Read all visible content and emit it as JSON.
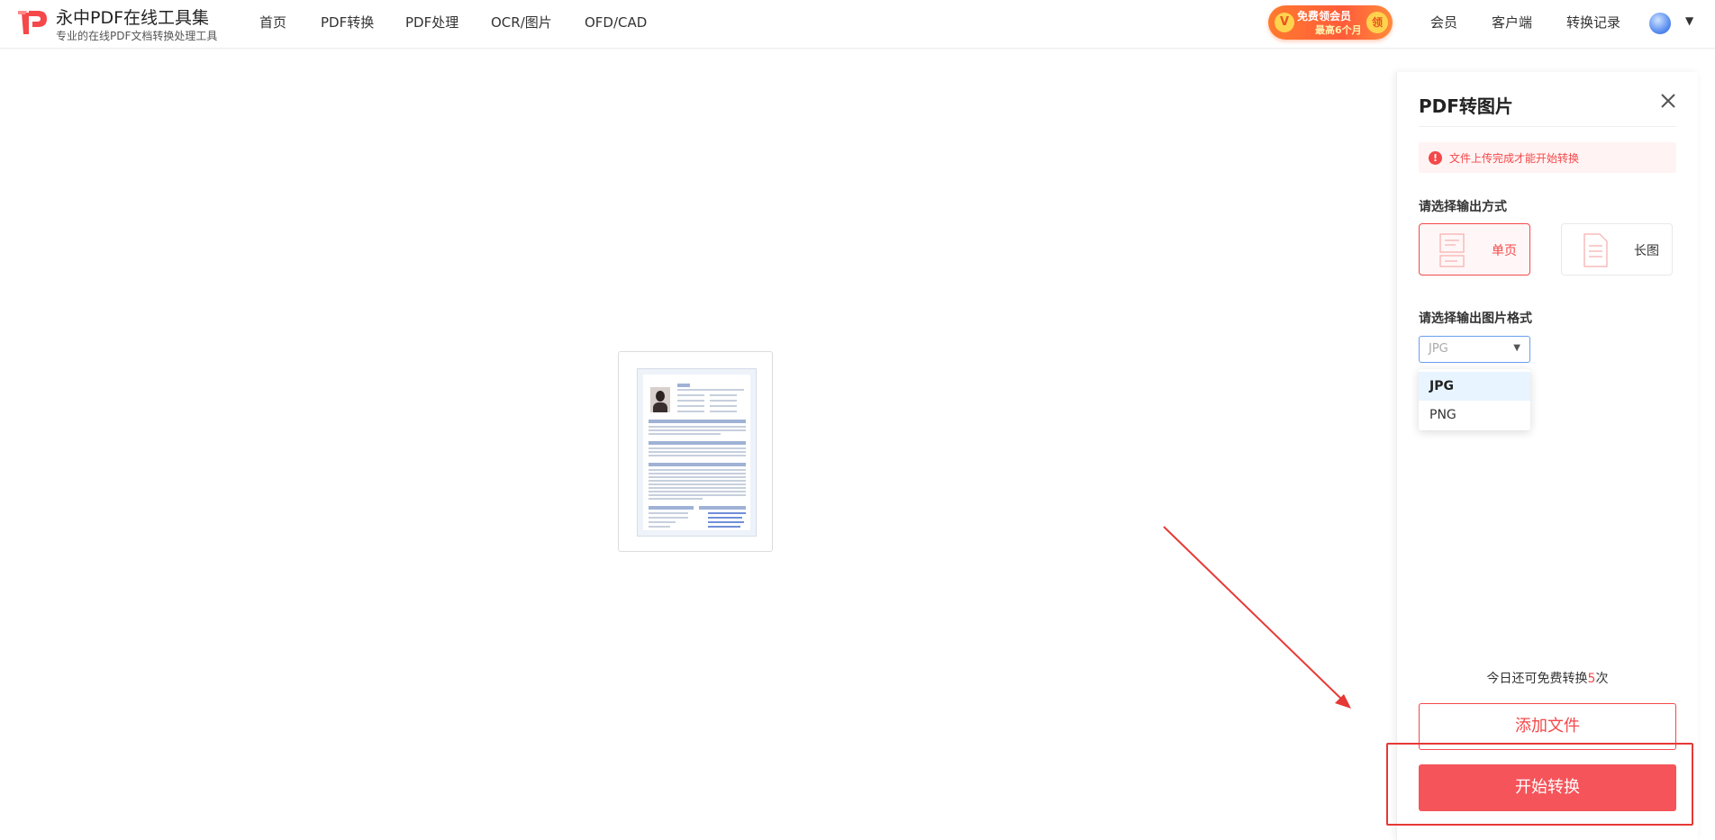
{
  "header": {
    "brand_title": "永中PDF在线工具集",
    "brand_subtitle": "专业的在线PDF文档转换处理工具",
    "nav": [
      "首页",
      "PDF转换",
      "PDF处理",
      "OCR/图片",
      "OFD/CAD"
    ],
    "promo": {
      "line1": "免费领会员",
      "line2": "最高6个月",
      "badge": "领",
      "icon": "V"
    },
    "right_links": [
      "会员",
      "客户端",
      "转换记录"
    ],
    "avatar_icon": "user-avatar"
  },
  "panel": {
    "title": "PDF转图片",
    "alert_icon": "!",
    "alert_text": "文件上传完成才能开始转换",
    "output_mode_label": "请选择输出方式",
    "output_modes": [
      {
        "label": "单页",
        "icon": "single-page-icon",
        "active": true
      },
      {
        "label": "长图",
        "icon": "long-image-icon",
        "active": false
      }
    ],
    "format_label": "请选择输出图片格式",
    "format_selected": "JPG",
    "format_options": [
      "JPG",
      "PNG"
    ],
    "remaining_prefix": "今日还可免费转换",
    "remaining_count": "5",
    "remaining_suffix": "次",
    "add_file": "添加文件",
    "start_convert": "开始转换"
  },
  "colors": {
    "accent": "#f5484a",
    "start_button": "#f5545a",
    "annotation": "#e53935",
    "selected_option_bg": "#e8f4ff"
  }
}
